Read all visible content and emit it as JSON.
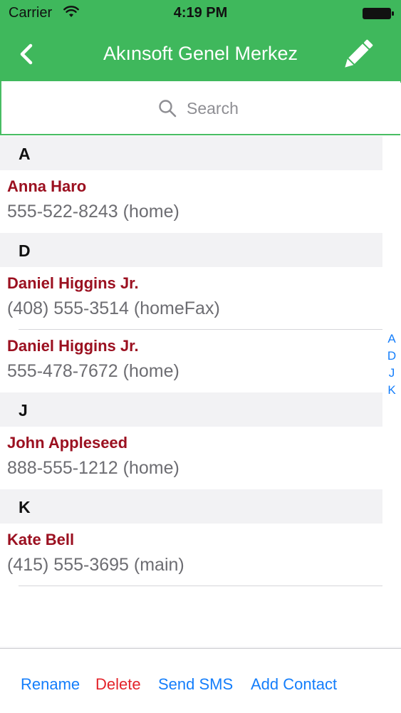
{
  "status_bar": {
    "carrier": "Carrier",
    "time": "4:19 PM"
  },
  "nav_bar": {
    "title": "Akınsoft Genel Merkez",
    "back_icon": "chevron-left-icon",
    "edit_icon": "pencil-icon"
  },
  "search": {
    "placeholder": "Search",
    "value": ""
  },
  "sections": [
    {
      "letter": "A",
      "contacts": [
        {
          "name": "Anna Haro",
          "phone": "555-522-8243 (home)"
        }
      ]
    },
    {
      "letter": "D",
      "contacts": [
        {
          "name": "Daniel Higgins Jr.",
          "phone": "(408) 555-3514 (homeFax)"
        },
        {
          "name": "Daniel Higgins Jr.",
          "phone": "555-478-7672 (home)"
        }
      ]
    },
    {
      "letter": "J",
      "contacts": [
        {
          "name": "John Appleseed",
          "phone": "888-555-1212 (home)"
        }
      ]
    },
    {
      "letter": "K",
      "contacts": [
        {
          "name": "Kate Bell",
          "phone": "(415) 555-3695 (main)"
        }
      ]
    }
  ],
  "section_index": [
    "A",
    "D",
    "J",
    "K"
  ],
  "toolbar": {
    "rename_label": "Rename",
    "delete_label": "Delete",
    "send_sms_label": "Send SMS",
    "add_contact_label": "Add Contact"
  },
  "colors": {
    "nav_green": "#3fb85c",
    "contact_name": "#9b1020",
    "link_blue": "#147efb",
    "delete_red": "#e3232a"
  }
}
